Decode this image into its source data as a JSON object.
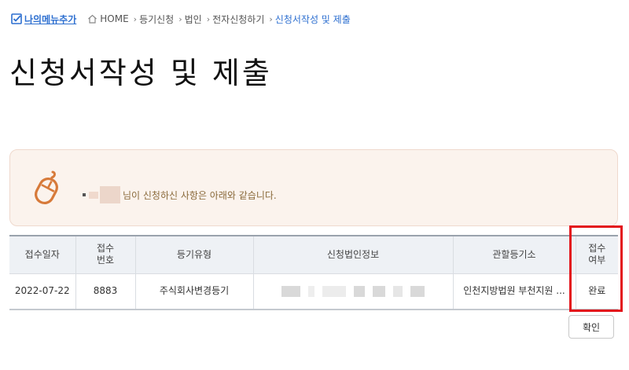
{
  "topbar": {
    "my_menu_label": "나의메뉴추가",
    "breadcrumb": {
      "home": "HOME",
      "items": [
        "등기신청",
        "법인",
        "전자신청하기"
      ],
      "current": "신청서작성 및 제출"
    }
  },
  "page_title": "신청서작성 및 제출",
  "notice": {
    "message": "님이 신청하신 사항은 아래와 같습니다."
  },
  "table": {
    "headers": [
      "접수일자",
      "접수\n번호",
      "등기유형",
      "신청법인정보",
      "관할등기소",
      "접수\n여부"
    ],
    "rows": [
      {
        "date": "2022-07-22",
        "number": "8883",
        "type": "주식회사변경등기",
        "company": "",
        "registry": "인천지방법원 부천지원 ...",
        "status": "완료"
      }
    ]
  },
  "buttons": {
    "confirm": "확인"
  },
  "colors": {
    "accent_blue": "#2d6fd0",
    "highlight_red": "#e3141b",
    "notice_bg": "#fbf3ed",
    "header_bg": "#eef1f5"
  }
}
